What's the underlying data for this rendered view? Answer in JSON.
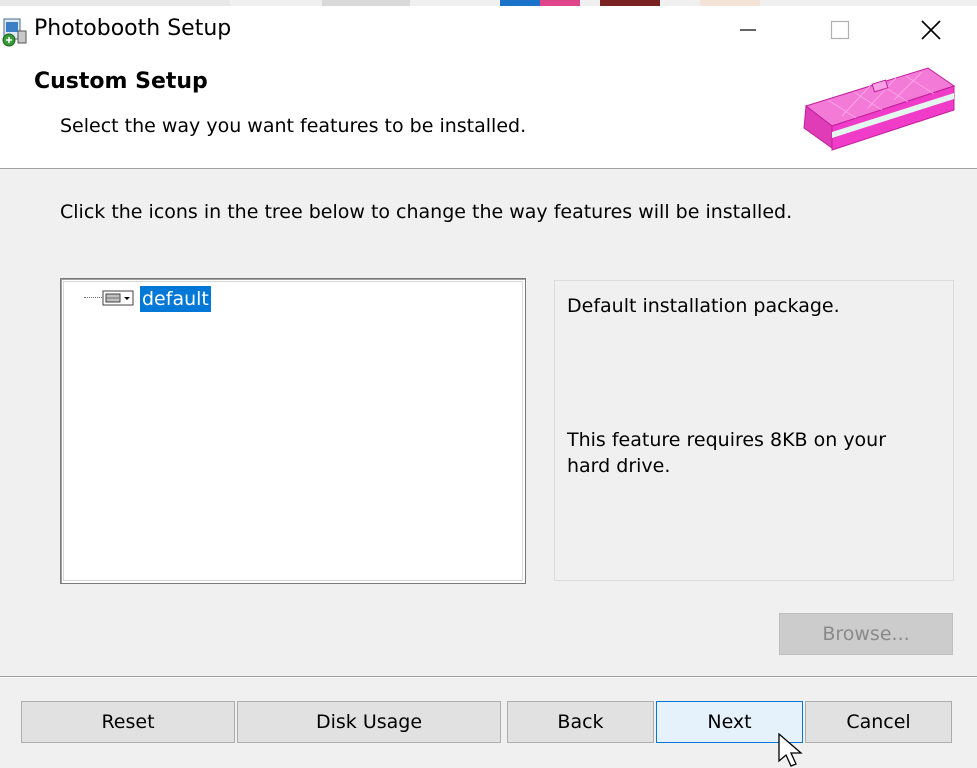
{
  "window": {
    "title": "Photobooth Setup",
    "icon": "installer-icon",
    "controls": [
      "minimize-icon",
      "maximize-icon",
      "close-icon"
    ]
  },
  "header": {
    "title": "Custom Setup",
    "subtitle": "Select the way you want features to be installed.",
    "banner_icon": "pink-package-icon"
  },
  "instructions": "Click the icons in the tree below to change the way features will be installed.",
  "tree": {
    "items": [
      {
        "label": "default",
        "icon": "hard-drive-feature-icon",
        "selected": true
      }
    ]
  },
  "feature_description": {
    "text": "Default installation package.",
    "size_text": "This feature requires 8KB on your hard drive."
  },
  "buttons": {
    "browse": "Browse...",
    "reset": "Reset",
    "disk_usage": "Disk Usage",
    "back": "Back",
    "next": "Next",
    "cancel": "Cancel"
  },
  "colors": {
    "selection": "#0078d7",
    "window_bg": "#f0f0f0",
    "banner_pink": "#f03cc8"
  }
}
